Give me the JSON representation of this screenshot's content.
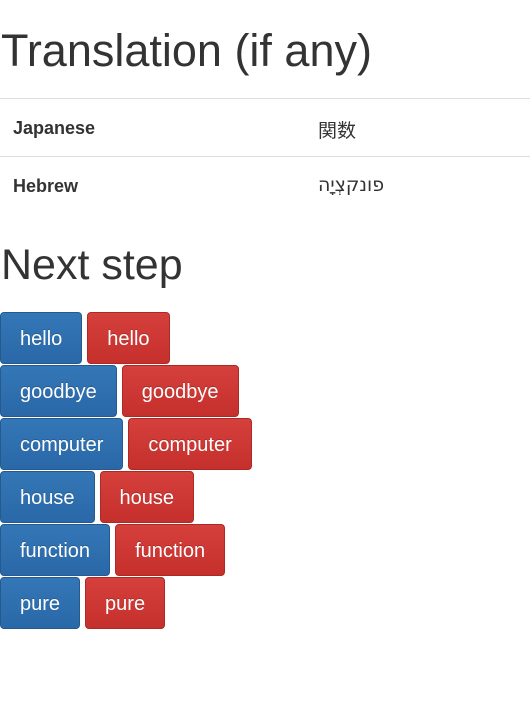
{
  "translation_section": {
    "heading": "Translation (if any)",
    "rows": [
      {
        "language": "Japanese",
        "word": "関数"
      },
      {
        "language": "Hebrew",
        "word": "פונקצְיָה"
      }
    ]
  },
  "next_step_section": {
    "heading": "Next step",
    "words": [
      {
        "blue": "hello",
        "red": "hello"
      },
      {
        "blue": "goodbye",
        "red": "goodbye"
      },
      {
        "blue": "computer",
        "red": "computer"
      },
      {
        "blue": "house",
        "red": "house"
      },
      {
        "blue": "function",
        "red": "function"
      },
      {
        "blue": "pure",
        "red": "pure"
      }
    ]
  },
  "colors": {
    "blue_button": "#2d6ca8",
    "red_button": "#d0393a",
    "text": "#333333",
    "divider": "#dddddd"
  }
}
